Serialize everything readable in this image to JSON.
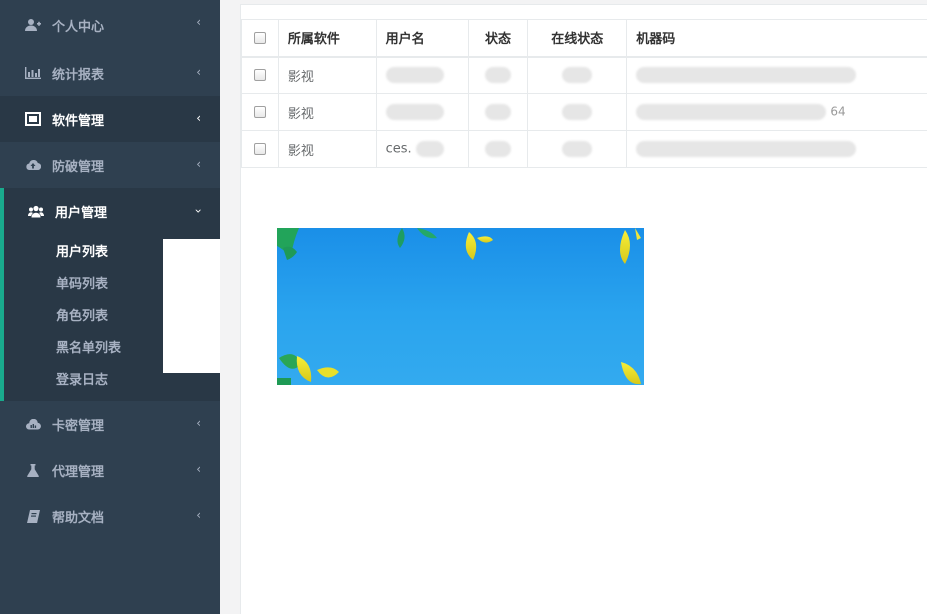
{
  "sidebar": {
    "items": [
      {
        "label": "个人中心",
        "icon": "user-plus-icon"
      },
      {
        "label": "统计报表",
        "icon": "bar-chart-icon"
      },
      {
        "label": "软件管理",
        "icon": "window-icon"
      },
      {
        "label": "防破管理",
        "icon": "cloud-upload-icon"
      },
      {
        "label": "用户管理",
        "icon": "users-icon"
      },
      {
        "label": "卡密管理",
        "icon": "cloud-icon"
      },
      {
        "label": "代理管理",
        "icon": "flask-icon"
      },
      {
        "label": "帮助文档",
        "icon": "book-icon"
      }
    ],
    "user_sub": [
      "用户列表",
      "单码列表",
      "角色列表",
      "黑名单列表",
      "登录日志"
    ],
    "chevron_left": "‹",
    "chevron_down": "›"
  },
  "table": {
    "headers": [
      "所属软件",
      "用户名",
      "状态",
      "在线状态",
      "机器码"
    ],
    "rows": [
      {
        "software": "影视",
        "username": "",
        "status": "",
        "online": "",
        "machine": ""
      },
      {
        "software": "影视",
        "username": "",
        "status": "",
        "online": "",
        "machine": "64"
      },
      {
        "software": "影视",
        "username": "ces.",
        "status": "",
        "online": "",
        "machine": ""
      }
    ]
  },
  "colors": {
    "sidebar": "#2f4050",
    "active": "#293846",
    "accent": "#19aa8d",
    "banner": "#1f98eb"
  }
}
